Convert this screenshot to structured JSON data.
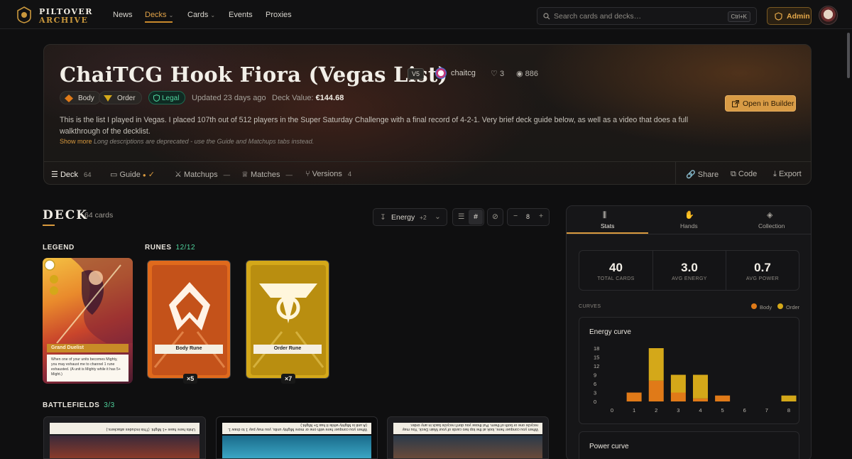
{
  "nav": {
    "logo_line1": "PILTOVER",
    "logo_line2": "ARCHIVE",
    "links": [
      "News",
      "Decks",
      "Cards",
      "Events",
      "Proxies"
    ],
    "search_placeholder": "Search cards and decks…",
    "search_shortcut": "Ctrl+K",
    "admin_label": "Admin"
  },
  "deck_header": {
    "title": "ChaiTCG Hook Fiora (Vegas List)",
    "version": "V5",
    "author": "chaitcg",
    "likes": "3",
    "views": "886",
    "domains": [
      "Body",
      "Order"
    ],
    "legal": "Legal",
    "updated": "Updated 23 days ago",
    "value_label": "Deck Value:",
    "value": "€144.68",
    "description": "This is the list I played in Vegas. I placed 107th out of 512 players in the Super Saturday Challenge with a final record of 4-2-1. Very brief deck guide below, as well as a video that does a full walkthrough of the decklist.",
    "show_more": "Show more",
    "deprecated_note": "Long descriptions are deprecated - use the Guide and Matchups tabs instead.",
    "open_builder": "Open in Builder",
    "tabs": [
      {
        "label": "Deck",
        "count": "64"
      },
      {
        "label": "Guide",
        "count": ""
      },
      {
        "label": "Matchups",
        "count": "—"
      },
      {
        "label": "Matches",
        "count": "—"
      },
      {
        "label": "Versions",
        "count": "4"
      }
    ],
    "actions": [
      "Share",
      "Code",
      "Export"
    ]
  },
  "deck": {
    "heading": "DECK",
    "count": "64 cards",
    "sort_label": "Energy",
    "sort_extra": "+2",
    "zoom_value": "8",
    "legend_label": "LEGEND",
    "legend_card_name": "Grand Duelist",
    "legend_card_text": "When one of your units becomes Mighty, you may exhaust me to channel 1 rune exhausted. (A unit is Mighty while it has 5+ Might.)",
    "runes_label": "RUNES",
    "runes_count": "12/12",
    "runes": [
      {
        "name": "Body Rune",
        "qty": "×5",
        "color": "#e06a1c"
      },
      {
        "name": "Order Rune",
        "qty": "×7",
        "color": "#d4a819"
      }
    ],
    "battlefields_label": "BATTLEFIELDS",
    "battlefields_count": "3/3",
    "battlefields": [
      "Units here have +1 Might. (This includes attackers.)",
      "When you conquer here with one or more Mighty units, you may pay 1 to draw 1. (A unit is Mighty while it has 5+ Might.)",
      "When you conquer here, look at the top two cards of your Main Deck. You may recycle one or both of them. Put those you don't recycle back in any order."
    ]
  },
  "stats": {
    "tabs": [
      "Stats",
      "Hands",
      "Collection"
    ],
    "summary": [
      {
        "value": "40",
        "label": "TOTAL CARDS"
      },
      {
        "value": "3.0",
        "label": "AVG ENERGY"
      },
      {
        "value": "0.7",
        "label": "AVG POWER"
      }
    ],
    "curves_label": "CURVES",
    "legend": [
      {
        "name": "Body",
        "color": "#e07a18"
      },
      {
        "name": "Order",
        "color": "#d4a819"
      }
    ],
    "energy_title": "Energy curve",
    "power_title": "Power curve"
  },
  "chart_data": {
    "type": "bar",
    "title": "Energy curve",
    "categories": [
      "0",
      "1",
      "2",
      "3",
      "4",
      "5",
      "6",
      "7",
      "8"
    ],
    "series": [
      {
        "name": "Body",
        "values": [
          0,
          3,
          7,
          3,
          1,
          2,
          0,
          0,
          0
        ]
      },
      {
        "name": "Order",
        "values": [
          0,
          0,
          11,
          6,
          8,
          0,
          0,
          0,
          2
        ]
      }
    ],
    "yticks": [
      "0",
      "3",
      "6",
      "9",
      "12",
      "15",
      "18"
    ],
    "ylim": [
      0,
      18
    ],
    "stacked": true
  }
}
